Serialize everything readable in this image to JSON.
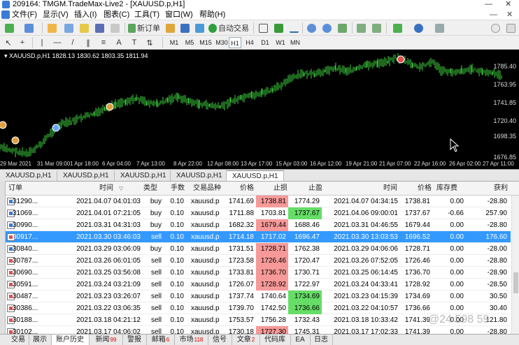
{
  "window": {
    "title": "209164: TMGM.TradeMax-Live2 - [XAUUSD.p,H1]",
    "minimize": "—",
    "close": "✕"
  },
  "menu": {
    "items": [
      "文件(F)",
      "显示(V)",
      "插入(I)",
      "图表(C)",
      "工具(T)",
      "窗口(W)",
      "帮助(H)"
    ],
    "mdi_minimize": "—",
    "mdi_close": "✕"
  },
  "toolbar": {
    "new_order_label": "新订单",
    "auto_trading_label": "自动交易",
    "timeframes": [
      "M1",
      "M5",
      "M15",
      "M30",
      "H1",
      "H4",
      "D1",
      "W1",
      "MN"
    ],
    "active_timeframe": "H1"
  },
  "chart": {
    "header": "▾ XAUUSD.p,H1  1828.13 1830.62 1803.35 1811.94",
    "y_ticks": [
      "1785.40",
      "1763.95",
      "1741.85",
      "1720.40",
      "1698.35",
      "1676.85"
    ],
    "x_ticks": [
      "29 Mar 2021",
      "31 Mar 09:00",
      "1 Apr 18:00",
      "6 Apr 04:00",
      "7 Apr 13:00",
      "8 Apr 22:00",
      "12 Apr 08:00",
      "13 Apr 17:00",
      "15 Apr 03:00",
      "16 Apr 12:00",
      "19 Apr 21:00",
      "21 Apr 07:00",
      "22 Apr 16:00",
      "26 Apr 02:00",
      "27 Apr 11:00"
    ],
    "colors": {
      "background": "#000000",
      "bull": "#3ecf3e",
      "axis_text": "#dddddd",
      "marker": "#e8b03c"
    }
  },
  "chart_tabs": [
    "XAUUSD.p,H1",
    "XAUUSD.p,H1",
    "XAUUSD.p,H1",
    "XAUUSD.p,H1",
    "XAUUSD.p,H1"
  ],
  "active_chart_tab": 4,
  "table": {
    "headers": {
      "order": "订单",
      "open_time": "时间",
      "type": "类型",
      "lots": "手数",
      "symbol": "交易品种",
      "open_price": "价格",
      "sl": "止损",
      "tp": "止盈",
      "close_time": "时间",
      "close_price": "价格",
      "swap": "库存费",
      "profit": "获利"
    },
    "rows": [
      {
        "order": "31290...",
        "open_time": "2021.04.07 04:01:03",
        "type": "buy",
        "lots": "0.10",
        "symbol": "xauusd.p",
        "open_price": "1741.69",
        "sl": "1738.81",
        "tp": "1774.29",
        "close_time": "2021.04.07 04:34:15",
        "close_price": "1738.81",
        "swap": "0.00",
        "profit": "-28.80",
        "hit": "sl"
      },
      {
        "order": "31069...",
        "open_time": "2021.04.01 07:21:05",
        "type": "buy",
        "lots": "0.10",
        "symbol": "xauusd.p",
        "open_price": "1711.88",
        "sl": "1703.81",
        "tp": "1737.67",
        "close_time": "2021.04.06 09:00:01",
        "close_price": "1737.67",
        "swap": "-0.66",
        "profit": "257.90",
        "hit": "tp"
      },
      {
        "order": "30990...",
        "open_time": "2021.03.31 04:31:03",
        "type": "buy",
        "lots": "0.10",
        "symbol": "xauusd.p",
        "open_price": "1682.32",
        "sl": "1679.44",
        "tp": "1688.46",
        "close_time": "2021.03.31 04:46:55",
        "close_price": "1679.44",
        "swap": "0.00",
        "profit": "-28.80",
        "hit": "sl"
      },
      {
        "order": "30917...",
        "open_time": "2021.03.30 03:46:03",
        "type": "sell",
        "lots": "0.10",
        "symbol": "xauusd.p",
        "open_price": "1714.18",
        "sl": "1717.02",
        "tp": "1696.47",
        "close_time": "2021.03.30 13:03:53",
        "close_price": "1696.52",
        "swap": "0.00",
        "profit": "176.60",
        "hit": "tp",
        "selected": true
      },
      {
        "order": "30840...",
        "open_time": "2021.03.29 03:06:09",
        "type": "buy",
        "lots": "0.10",
        "symbol": "xauusd.p",
        "open_price": "1731.51",
        "sl": "1728.71",
        "tp": "1762.38",
        "close_time": "2021.03.29 04:06:06",
        "close_price": "1728.71",
        "swap": "0.00",
        "profit": "-28.00",
        "hit": "sl"
      },
      {
        "order": "30787...",
        "open_time": "2021.03.26 06:01:05",
        "type": "sell",
        "lots": "0.10",
        "symbol": "xauusd.p",
        "open_price": "1723.58",
        "sl": "1726.46",
        "tp": "1720.47",
        "close_time": "2021.03.26 07:52:05",
        "close_price": "1726.46",
        "swap": "0.00",
        "profit": "-28.80",
        "hit": "sl"
      },
      {
        "order": "30690...",
        "open_time": "2021.03.25 03:56:08",
        "type": "sell",
        "lots": "0.10",
        "symbol": "xauusd.p",
        "open_price": "1733.81",
        "sl": "1736.70",
        "tp": "1730.71",
        "close_time": "2021.03.25 06:14:45",
        "close_price": "1736.70",
        "swap": "0.00",
        "profit": "-28.90",
        "hit": "sl"
      },
      {
        "order": "30591...",
        "open_time": "2021.03.24 03:21:09",
        "type": "sell",
        "lots": "0.10",
        "symbol": "xauusd.p",
        "open_price": "1726.07",
        "sl": "1728.92",
        "tp": "1722.97",
        "close_time": "2021.03.24 04:33:41",
        "close_price": "1728.92",
        "swap": "0.00",
        "profit": "-28.50",
        "hit": "sl"
      },
      {
        "order": "30487...",
        "open_time": "2021.03.23 03:26:07",
        "type": "sell",
        "lots": "0.10",
        "symbol": "xauusd.p",
        "open_price": "1737.74",
        "sl": "1740.64",
        "tp": "1734.69",
        "close_time": "2021.03.23 04:15:39",
        "close_price": "1734.69",
        "swap": "0.00",
        "profit": "30.50",
        "hit": "tp"
      },
      {
        "order": "30386...",
        "open_time": "2021.03.22 03:06:35",
        "type": "sell",
        "lots": "0.10",
        "symbol": "xauusd.p",
        "open_price": "1739.70",
        "sl": "1742.50",
        "tp": "1736.66",
        "close_time": "2021.03.22 04:10:57",
        "close_price": "1736.66",
        "swap": "0.00",
        "profit": "30.40",
        "hit": "tp"
      },
      {
        "order": "30188...",
        "open_time": "2021.03.18 04:21:12",
        "type": "sell",
        "lots": "0.10",
        "symbol": "xauusd.p",
        "open_price": "1753.57",
        "sl": "1756.28",
        "tp": "1732.43",
        "close_time": "2021.03.18 10:33:42",
        "close_price": "1741.39",
        "swap": "0.00",
        "profit": "121.80",
        "hit": "none"
      },
      {
        "order": "30102...",
        "open_time": "2021.03.17 04:06:02",
        "type": "sell",
        "lots": "0.10",
        "symbol": "xauusd.p",
        "open_price": "1730.18",
        "sl": "1727.30",
        "tp": "1745.31",
        "close_time": "2021.03.17 17:02:33",
        "close_price": "1741.39",
        "swap": "0.00",
        "profit": "-28.80",
        "hit": "sl"
      }
    ]
  },
  "bottom_tabs": [
    {
      "label": "交易",
      "count": ""
    },
    {
      "label": "展示",
      "count": ""
    },
    {
      "label": "账户历史",
      "count": ""
    },
    {
      "label": "新闻",
      "count": "99"
    },
    {
      "label": "警报",
      "count": ""
    },
    {
      "label": "邮箱",
      "count": "6"
    },
    {
      "label": "市场",
      "count": "118"
    },
    {
      "label": "信号",
      "count": ""
    },
    {
      "label": "文章",
      "count": "2"
    },
    {
      "label": "代码库",
      "count": ""
    },
    {
      "label": "EA",
      "count": ""
    },
    {
      "label": "日志",
      "count": ""
    }
  ],
  "active_bottom_tab": 2,
  "watermark": "@24 598 59"
}
